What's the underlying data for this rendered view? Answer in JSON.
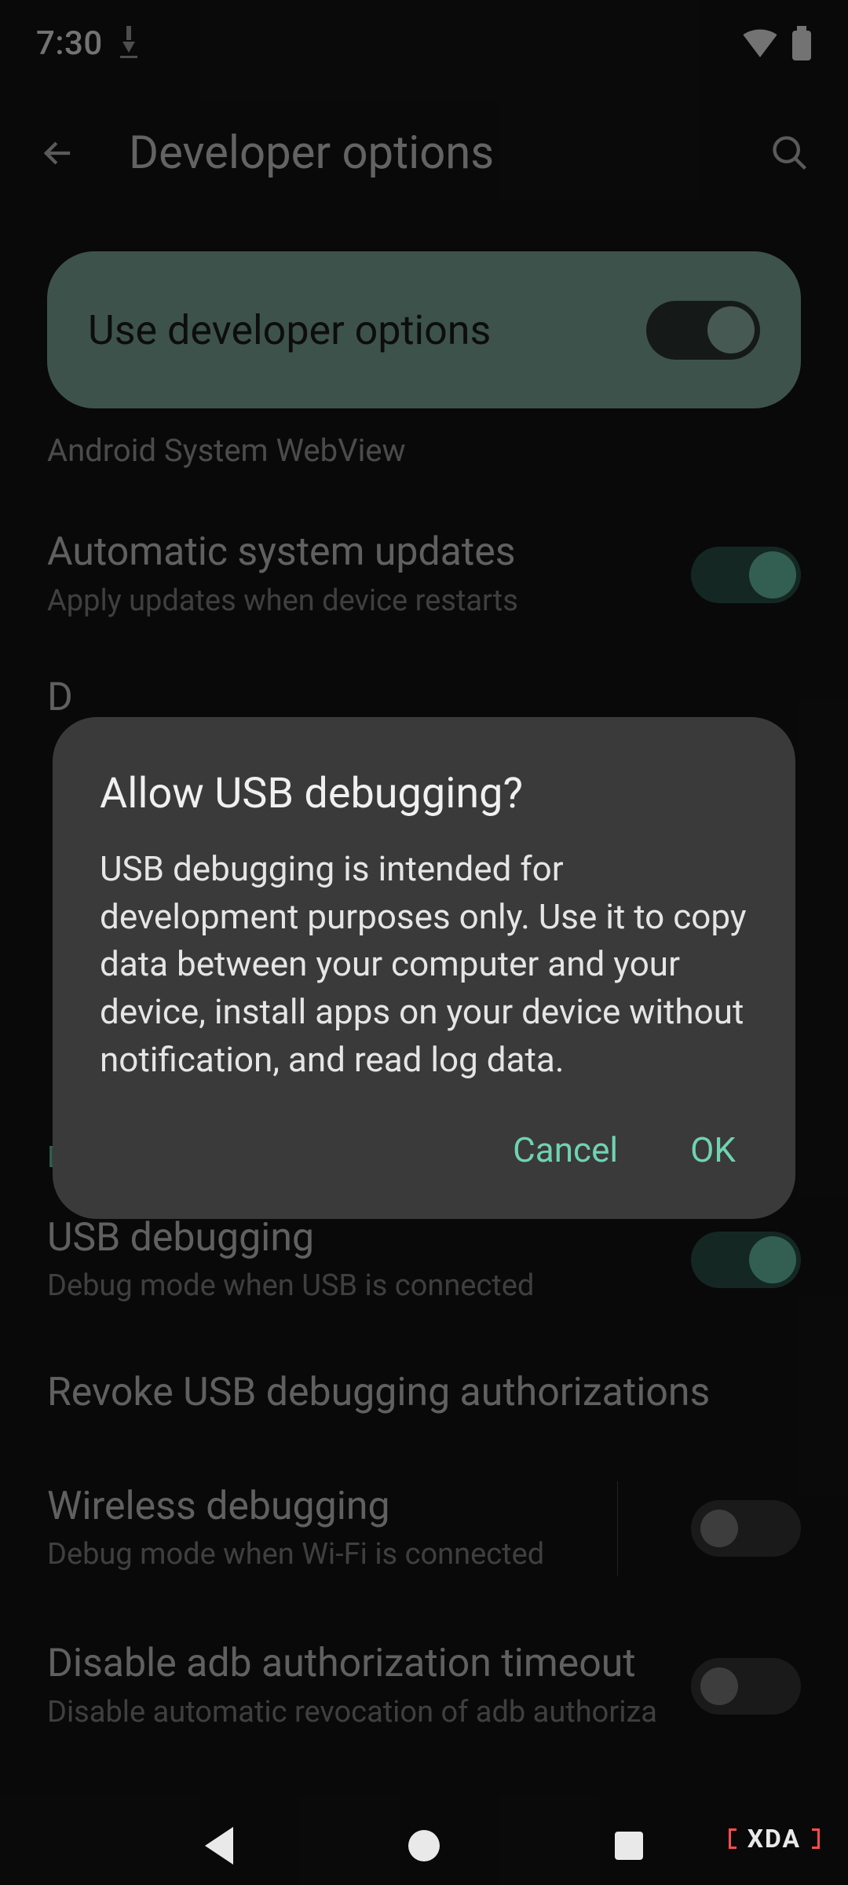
{
  "status": {
    "time": "7:30"
  },
  "header": {
    "title": "Developer options"
  },
  "master": {
    "label": "Use developer options",
    "on": true
  },
  "webview_label": "Android System WebView",
  "rows": {
    "auto_update": {
      "title": "Automatic system updates",
      "sub": "Apply updates when device restarts",
      "on": true
    },
    "dsu": {
      "title": "D",
      "sub": ""
    },
    "section": "Debugging",
    "usb": {
      "title": "USB debugging",
      "sub": "Debug mode when USB is connected",
      "on": true
    },
    "revoke": {
      "title": "Revoke USB debugging authorizations"
    },
    "wireless": {
      "title": "Wireless debugging",
      "sub": "Debug mode when Wi-Fi is connected",
      "on": false
    },
    "disable_auth": {
      "title": "Disable adb authorization timeout",
      "sub": "Disable automatic revocation of adb authoriza"
    }
  },
  "dialog": {
    "title": "Allow USB debugging?",
    "body": "USB debugging is intended for development purposes only. Use it to copy data between your computer and your device, install apps on your device without notification, and read log data.",
    "cancel": "Cancel",
    "ok": "OK"
  },
  "watermark": "XDA"
}
